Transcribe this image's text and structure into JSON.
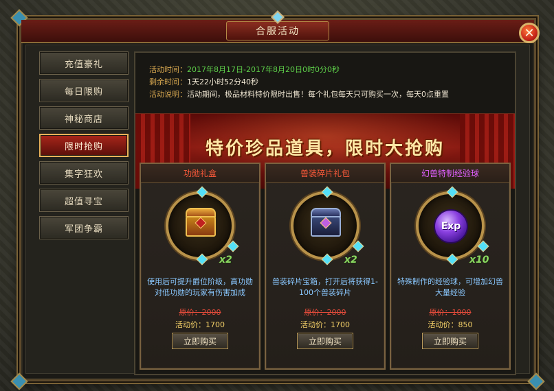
{
  "window": {
    "title": "合服活动",
    "close_label": "✕"
  },
  "sidebar": {
    "items": [
      {
        "label": "充值豪礼",
        "active": false
      },
      {
        "label": "每日限购",
        "active": false
      },
      {
        "label": "神秘商店",
        "active": false
      },
      {
        "label": "限时抢购",
        "active": true
      },
      {
        "label": "集字狂欢",
        "active": false
      },
      {
        "label": "超值寻宝",
        "active": false
      },
      {
        "label": "军团争霸",
        "active": false
      }
    ]
  },
  "info": {
    "time_key": "活动时间：",
    "time_val": "2017年8月17日-2017年8月20日0时0分0秒",
    "remain_key": "剩余时间：",
    "remain_val": "1天22小时52分40秒",
    "desc_key": "活动说明：",
    "desc_val": "活动期间，极品材料特价限时出售！每个礼包每天只可购买一次，每天0点重置"
  },
  "banner": {
    "text": "特价珍品道具，限时大抢购"
  },
  "cards": [
    {
      "title": "功勋礼盒",
      "title_color": "#ff5a3a",
      "icon": "treasure-chest-gold",
      "qty": "x2",
      "desc": "使用后可提升爵位阶级，高功勋对低功勋的玩家有伤害加成",
      "price_old": "原价：2000",
      "price_new": "活动价：1700",
      "buy_label": "立即购买"
    },
    {
      "title": "兽装碎片礼包",
      "title_color": "#ff5a3a",
      "icon": "treasure-chest-blue",
      "qty": "x2",
      "desc": "兽装碎片宝箱，打开后将获得1-100个兽装碎片",
      "price_old": "原价：2000",
      "price_new": "活动价：1700",
      "buy_label": "立即购买"
    },
    {
      "title": "幻兽特制经验球",
      "title_color": "#e060ff",
      "icon": "exp-orb",
      "icon_text": "Exp",
      "qty": "x10",
      "desc": "特殊制作的经验球，可增加幻兽大量经验",
      "price_old": "原价：1000",
      "price_new": "活动价：850",
      "buy_label": "立即购买"
    }
  ]
}
